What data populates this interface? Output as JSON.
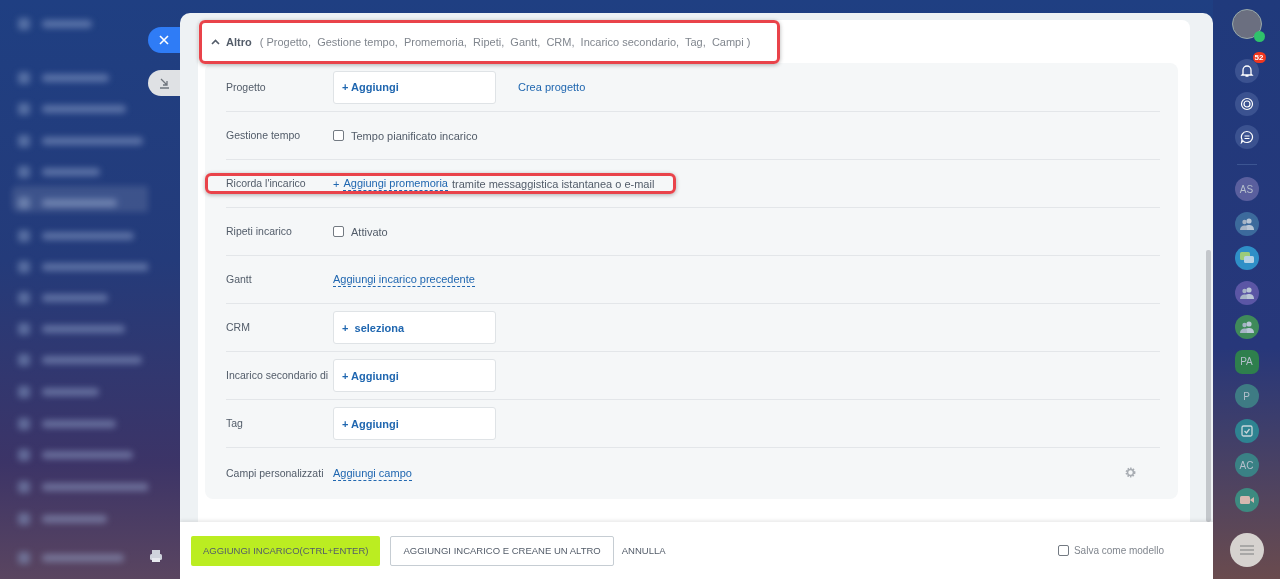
{
  "section": {
    "title": "Altro",
    "summary": "( Progetto,  Gestione tempo,  Promemoria,  Ripeti,  Gantt,  CRM,  Incarico secondario,  Tag,  Campi )",
    "expanded": true,
    "highlighted": true
  },
  "rows": [
    {
      "kind": "add_box",
      "label": "Progetto",
      "button": "+ Aggiungi",
      "link": "Crea progetto",
      "highlighted": false
    },
    {
      "kind": "checkbox",
      "label": "Gestione tempo",
      "option": "Tempo pianificato incarico",
      "checked": false,
      "highlighted": false
    },
    {
      "kind": "reminder",
      "label": "Ricorda l'incarico",
      "prefix": "+",
      "link": "Aggiungi promemoria",
      "text": "tramite messaggistica istantanea o e-mail",
      "highlighted": true
    },
    {
      "kind": "checkbox",
      "label": "Ripeti incarico",
      "option": "Attivato",
      "checked": false,
      "highlighted": false
    },
    {
      "kind": "link",
      "label": "Gantt",
      "link": "Aggiungi incarico precedente",
      "highlighted": false
    },
    {
      "kind": "add_box",
      "label": "CRM",
      "button": "+  seleziona",
      "highlighted": false
    },
    {
      "kind": "add_box",
      "label": "Incarico secondario di",
      "button": "+ Aggiungi",
      "highlighted": false
    },
    {
      "kind": "add_box",
      "label": "Tag",
      "button": "+ Aggiungi",
      "highlighted": false
    },
    {
      "kind": "custom_fields",
      "label": "Campi personalizzati",
      "link": "Aggiungi campo",
      "highlighted": false
    }
  ],
  "footer": {
    "primary": "AGGIUNGI INCARICO(CTRL+ENTER)",
    "secondary": "AGGIUNGI INCARICO E CREANE UN ALTRO",
    "cancel": "ANNULLA",
    "template": {
      "label": "Salva come modello",
      "checked": false
    }
  },
  "right_bar": {
    "notification_count": "52",
    "items": [
      {
        "kind": "initials",
        "text": "AS",
        "color": "#5a5f9e"
      },
      {
        "kind": "group",
        "color": "#3c6a9c"
      },
      {
        "kind": "chat",
        "color": "#2f8fc7"
      },
      {
        "kind": "group",
        "color": "#5b56a5"
      },
      {
        "kind": "group",
        "color": "#3f8a5a"
      },
      {
        "kind": "initials_hex",
        "text": "PA",
        "color": "#2e7f4d"
      },
      {
        "kind": "initials",
        "text": "P",
        "color": "#3e7b84"
      },
      {
        "kind": "task",
        "color": "#2e8391"
      },
      {
        "kind": "initials",
        "text": "AC",
        "color": "#3a8185"
      },
      {
        "kind": "video",
        "color": "#3d8a80"
      }
    ]
  }
}
